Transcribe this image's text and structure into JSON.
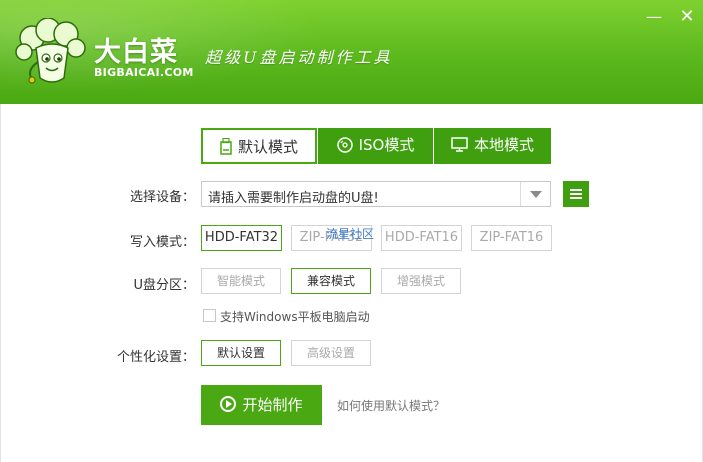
{
  "window": {
    "minimize_label": "—",
    "close_label": "✕"
  },
  "brand": {
    "name": "大白菜",
    "domain": "BIGBAICAI.COM",
    "slogan": "超级U盘启动制作工具"
  },
  "tabs": [
    {
      "label": "默认模式",
      "selected": true
    },
    {
      "label": "ISO模式",
      "selected": false
    },
    {
      "label": "本地模式",
      "selected": false
    }
  ],
  "device": {
    "label": "选择设备：",
    "value": "请插入需要制作启动盘的U盘!"
  },
  "write_mode": {
    "label": "写入模式：",
    "options": [
      "HDD-FAT32",
      "ZIP-FAT32",
      "HDD-FAT16",
      "ZIP-FAT16"
    ],
    "selected": "HDD-FAT32"
  },
  "watermark": "流星社区",
  "partition": {
    "label": "U盘分区：",
    "options": [
      "智能模式",
      "兼容模式",
      "增强模式"
    ],
    "selected": "兼容模式"
  },
  "tablet_support": {
    "label": "支持Windows平板电脑启动",
    "checked": false
  },
  "personalize": {
    "label": "个性化设置：",
    "options": [
      "默认设置",
      "高级设置"
    ],
    "selected": "默认设置"
  },
  "start_button": "开始制作",
  "help_link": "如何使用默认模式？",
  "colors": {
    "brand_green": "#5bb81d",
    "dark_green": "#3f9f0e",
    "selected_border": "#4aa812"
  }
}
